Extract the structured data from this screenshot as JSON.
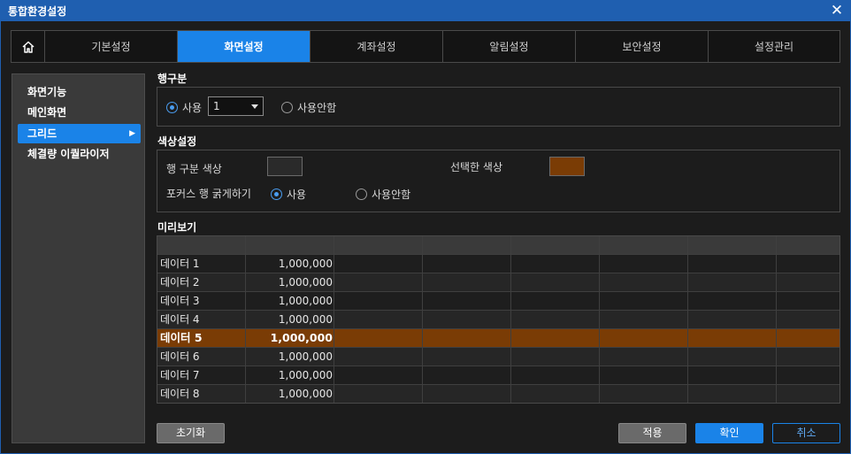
{
  "window": {
    "title": "통합환경설정",
    "close_icon": "close-icon"
  },
  "tabs": [
    {
      "label": "기본설정"
    },
    {
      "label": "화면설정"
    },
    {
      "label": "계좌설정"
    },
    {
      "label": "알림설정"
    },
    {
      "label": "보안설정"
    },
    {
      "label": "설정관리"
    }
  ],
  "sidebar": {
    "items": [
      {
        "label": "화면기능"
      },
      {
        "label": "메인화면"
      },
      {
        "label": "그리드"
      },
      {
        "label": "체결량 이퀄라이저"
      }
    ]
  },
  "row_section": {
    "title": "행구분",
    "use_label": "사용",
    "select_value": "1",
    "no_use_label": "사용안함"
  },
  "color_section": {
    "title": "색상설정",
    "row_color_label": "행 구분 색상",
    "row_color": "#2a2a2a",
    "selected_color_label": "선택한 색상",
    "selected_color": "#7a3c05",
    "focus_label": "포커스 행 굵게하기",
    "focus_use_label": "사용",
    "focus_no_use_label": "사용안함"
  },
  "preview": {
    "title": "미리보기",
    "rows": [
      {
        "name": "데이터 1",
        "value": "1,000,000"
      },
      {
        "name": "데이터 2",
        "value": "1,000,000"
      },
      {
        "name": "데이터 3",
        "value": "1,000,000"
      },
      {
        "name": "데이터 4",
        "value": "1,000,000"
      },
      {
        "name": "데이터 5",
        "value": "1,000,000"
      },
      {
        "name": "데이터 6",
        "value": "1,000,000"
      },
      {
        "name": "데이터 7",
        "value": "1,000,000"
      },
      {
        "name": "데이터 8",
        "value": "1,000,000"
      }
    ]
  },
  "footer": {
    "reset_label": "초기화",
    "apply_label": "적용",
    "ok_label": "확인",
    "cancel_label": "취소"
  },
  "colors": {
    "accent": "#1a83e8",
    "titlebar": "#1f5fb0",
    "selected_row": "#7a3c05"
  }
}
